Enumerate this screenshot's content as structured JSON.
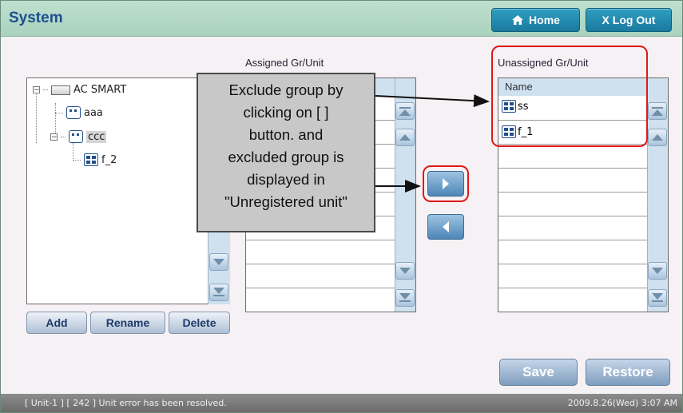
{
  "window": {
    "title": "System"
  },
  "header": {
    "home_label": "Home",
    "logout_label": "X Log Out"
  },
  "tree": {
    "root_label": "AC SMART",
    "items": [
      {
        "label": "aaa"
      },
      {
        "label": "ccc"
      },
      {
        "label": "f_2"
      }
    ],
    "buttons": {
      "add": "Add",
      "rename": "Rename",
      "delete": "Delete"
    }
  },
  "assigned": {
    "title": "Assigned Gr/Unit"
  },
  "unassigned": {
    "title": "Unassigned Gr/Unit",
    "header": "Name",
    "items": [
      {
        "label": "ss"
      },
      {
        "label": "f_1"
      }
    ]
  },
  "callout": {
    "text_lines": [
      "Exclude group by",
      "clicking on [ ]",
      "button. and",
      "excluded group is",
      "displayed in",
      "\"Unregistered unit\""
    ]
  },
  "actions": {
    "save": "Save",
    "restore": "Restore"
  },
  "status": {
    "message": "[ Unit-1 ] [ 242 ] Unit error has been resolved.",
    "datetime": "2009.8.26(Wed)  3:07 AM"
  },
  "colors": {
    "accent": "#1e4f8f",
    "highlight_red": "#e01818",
    "titlebar": "#bfe0cf"
  }
}
